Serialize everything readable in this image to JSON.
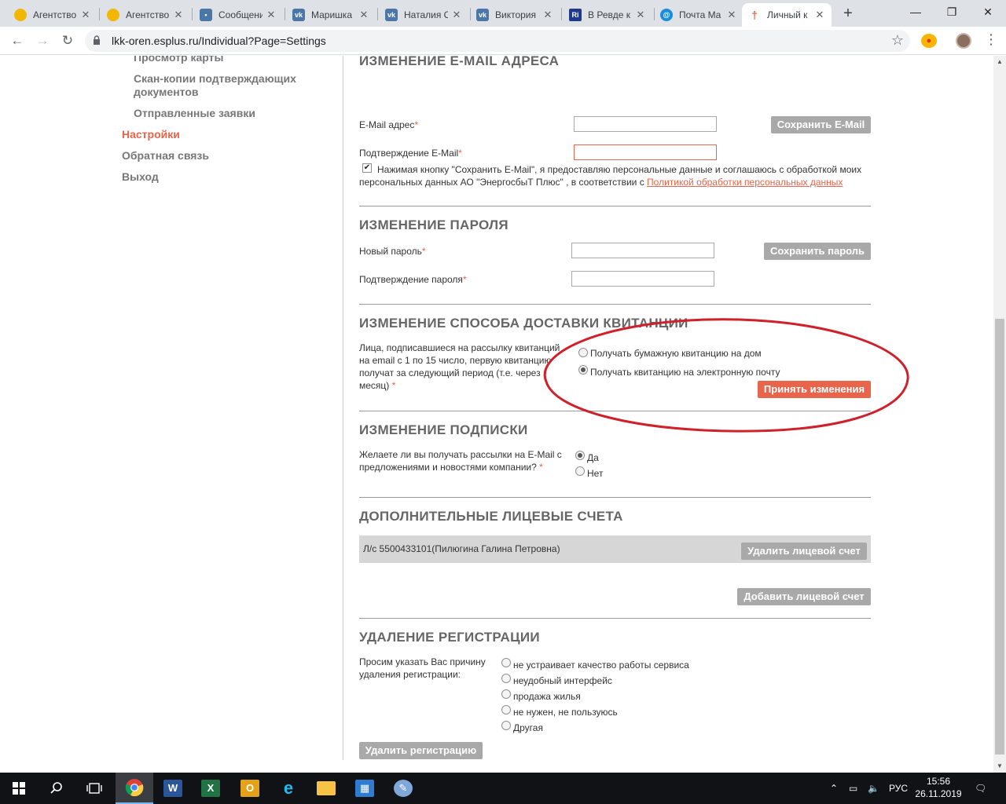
{
  "browser": {
    "tabs": [
      {
        "title": "Агентство",
        "icon": "agency-favicon",
        "color": "#f2b705"
      },
      {
        "title": "Агентство",
        "icon": "agency-favicon",
        "color": "#f2b705"
      },
      {
        "title": "Сообщения",
        "icon": "chat-favicon",
        "color": "#4a76a8"
      },
      {
        "title": "Маришка",
        "icon": "vk-favicon",
        "color": "#4a76a8"
      },
      {
        "title": "Наталия С",
        "icon": "vk-favicon",
        "color": "#4a76a8"
      },
      {
        "title": "Виктория",
        "icon": "vk-favicon",
        "color": "#4a76a8"
      },
      {
        "title": "В Ревде к",
        "icon": "ri-favicon",
        "color": "#1f3a8a"
      },
      {
        "title": "Почта Ma",
        "icon": "mail-favicon",
        "color": "#168de2"
      },
      {
        "title": "Личный к",
        "icon": "esplus-favicon",
        "color": "#e8644a"
      }
    ],
    "url": "lkk-oren.esplus.ru/Individual?Page=Settings"
  },
  "sidebar": {
    "items": [
      {
        "label": "Просмотр карты"
      },
      {
        "label": "Скан-копии подтверждающих документов"
      },
      {
        "label": "Отправленные заявки"
      },
      {
        "label": "Настройки"
      },
      {
        "label": "Обратная связь"
      },
      {
        "label": "Выход"
      }
    ]
  },
  "email_section": {
    "title": "ИЗМЕНЕНИЕ E-MAIL АДРЕСА",
    "email_label": "E-Mail адрес",
    "email_value": "",
    "confirm_label": "Подтверждение E-Mail",
    "confirm_value": "",
    "save_button": "Сохранить E-Mail",
    "consent_text": "Нажимая кнопку \"Сохранить E-Mail\", я предоставляю персональные данные и соглашаюсь с обработкой моих",
    "consent_text2": "персональных данных АО \"ЭнергосбыТ Плюс\" , в соответствии с",
    "consent_link": "Политикой обработки персональных данных",
    "consent_checked": true
  },
  "password_section": {
    "title": "ИЗМЕНЕНИЕ ПАРОЛЯ",
    "new_label": "Новый пароль",
    "confirm_label": "Подтверждение пароля",
    "save_button": "Сохранить пароль"
  },
  "delivery_section": {
    "title": "ИЗМЕНЕНИЕ СПОСОБА ДОСТАВКИ КВИТАНЦИИ",
    "description": "Лица, подписавшиеся на рассылку квитанций на email с 1 по 15 число, первую квитанцию получат за следующий период (т.е. через месяц)",
    "options": [
      "Получать бумажную квитанцию на дом",
      "Получать квитанцию на электронную почту"
    ],
    "selected": 1,
    "apply_button": "Принять изменения",
    "highlight_color": "#d0202a"
  },
  "subscription_section": {
    "title": "ИЗМЕНЕНИЕ ПОДПИСКИ",
    "question": "Желаете ли вы получать рассылки на E-Mail с предложениями и новостями компании?",
    "options": [
      "Да",
      "Нет"
    ],
    "selected": 0
  },
  "accounts_section": {
    "title": "ДОПОЛНИТЕЛЬНЫЕ ЛИЦЕВЫЕ СЧЕТА",
    "account": "Л/с 5500433101(Пилюгина Галина Петровна)",
    "delete_button": "Удалить лицевой счет",
    "add_button": "Добавить лицевой счет"
  },
  "delete_section": {
    "title": "УДАЛЕНИЕ РЕГИСТРАЦИИ",
    "question": "Просим указать Вас причину удаления регистрации:",
    "options": [
      "не устраивает качество работы сервиса",
      "неудобный интерфейс",
      "продажа жилья",
      "не нужен, не пользуюсь",
      "Другая"
    ],
    "delete_button": "Удалить регистрацию"
  },
  "taskbar": {
    "language": "РУС",
    "time": "15:56",
    "date": "26.11.2019"
  },
  "colors": {
    "accent": "#e8644a",
    "button_gray": "#a9a9a9"
  }
}
